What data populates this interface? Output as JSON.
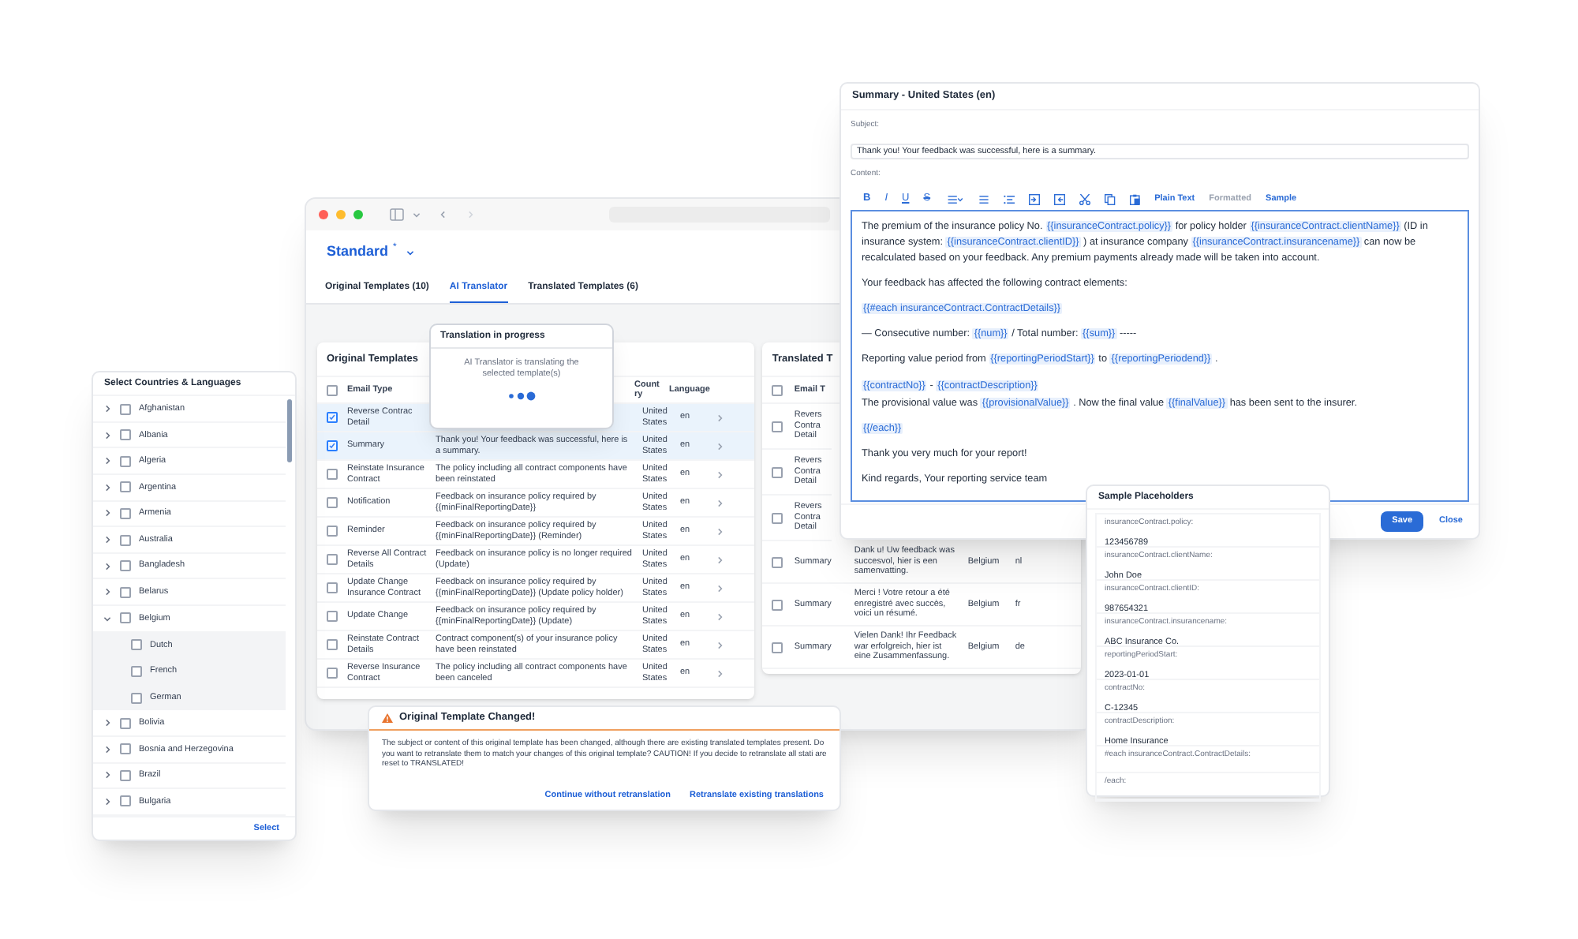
{
  "app_window": {
    "header": {
      "title": "Standard",
      "modified_mark": "*"
    },
    "tabs": [
      {
        "label": "Original Templates (10)",
        "selected": false
      },
      {
        "label": "AI Translator",
        "selected": true
      },
      {
        "label": "Translated Templates (6)",
        "selected": false
      }
    ],
    "original_templates": {
      "title": "Original Templates",
      "all_checked": false,
      "columns": [
        "Email Type",
        "Country",
        "Language"
      ],
      "rows": [
        {
          "email_type": "Reverse Contrac Detail",
          "country": "United States",
          "language": "en",
          "selected": true
        },
        {
          "email_type": "Summary",
          "subject": "Thank you! Your feedback was successful, here is a summary.",
          "country": "United States",
          "language": "en",
          "selected": true
        },
        {
          "email_type": "Reinstate Insurance Contract",
          "subject": "The policy including all contract components have been reinstated",
          "country": "United States",
          "language": "en",
          "selected": false
        },
        {
          "email_type": "Notification",
          "subject": "Feedback on insurance policy required by {{minFinalReportingDate}}",
          "country": "United States",
          "language": "en",
          "selected": false
        },
        {
          "email_type": "Reminder",
          "subject": "Feedback on insurance policy required by {{minFinalReportingDate}} (Reminder)",
          "country": "United States",
          "language": "en",
          "selected": false
        },
        {
          "email_type": "Reverse All Contract Details",
          "subject": "Feedback on insurance policy is no longer required (Update)",
          "country": "United States",
          "language": "en",
          "selected": false
        },
        {
          "email_type": "Update Change Insurance Contract",
          "subject": "Feedback on insurance policy required by {{minFinalReportingDate}} (Update policy holder)",
          "country": "United States",
          "language": "en",
          "selected": false
        },
        {
          "email_type": "Update Change",
          "subject": "Feedback on insurance policy required by {{minFinalReportingDate}} (Update)",
          "country": "United States",
          "language": "en",
          "selected": false
        },
        {
          "email_type": "Reinstate Contract Details",
          "subject": "Contract component(s) of your insurance policy have been reinstated",
          "country": "United States",
          "language": "en",
          "selected": false
        },
        {
          "email_type": "Reverse Insurance Contract",
          "subject": "The policy including all contract components have been canceled",
          "country": "United States",
          "language": "en",
          "selected": false
        }
      ]
    },
    "translated_templates": {
      "title": "Translated T",
      "all_checked": false,
      "columns": [
        "Email T"
      ],
      "rows": [
        {
          "email_type": "Revers Contra Detail",
          "selected": false
        },
        {
          "email_type": "Revers Contra Detail",
          "selected": false
        },
        {
          "email_type": "Revers Contra Detail",
          "selected": false
        },
        {
          "email_type": "Summary",
          "subject": "Dank u! Uw feedback was succesvol, hier is een samenvatting.",
          "country": "Belgium",
          "language": "nl",
          "selected": false
        },
        {
          "email_type": "Summary",
          "subject": "Merci ! Votre retour a été enregistré avec succès, voici un résumé.",
          "country": "Belgium",
          "language": "fr",
          "selected": false
        },
        {
          "email_type": "Summary",
          "subject": "Vielen Dank! Ihr Feedback war erfolgreich, hier ist eine Zusammenfassung.",
          "country": "Belgium",
          "language": "de",
          "selected": false
        }
      ]
    }
  },
  "progress_popup": {
    "title": "Translation in progress",
    "message": "AI Translator is translating the selected template(s)"
  },
  "country_panel": {
    "title": "Select Countries & Languages",
    "items": [
      {
        "label": "Afghanistan",
        "expanded": false,
        "checked": false
      },
      {
        "label": "Albania",
        "expanded": false,
        "checked": false
      },
      {
        "label": "Algeria",
        "expanded": false,
        "checked": false
      },
      {
        "label": "Argentina",
        "expanded": false,
        "checked": false
      },
      {
        "label": "Armenia",
        "expanded": false,
        "checked": false
      },
      {
        "label": "Australia",
        "expanded": false,
        "checked": false
      },
      {
        "label": "Bangladesh",
        "expanded": false,
        "checked": false
      },
      {
        "label": "Belarus",
        "expanded": false,
        "checked": false
      },
      {
        "label": "Belgium",
        "expanded": true,
        "checked": false,
        "children": [
          {
            "label": "Dutch",
            "checked": false
          },
          {
            "label": "French",
            "checked": false
          },
          {
            "label": "German",
            "checked": false
          }
        ]
      },
      {
        "label": "Bolivia",
        "expanded": false,
        "checked": false
      },
      {
        "label": "Bosnia and Herzegovina",
        "expanded": false,
        "checked": false
      },
      {
        "label": "Brazil",
        "expanded": false,
        "checked": false
      },
      {
        "label": "Bulgaria",
        "expanded": false,
        "checked": false
      }
    ],
    "button": "Select"
  },
  "change_dialog": {
    "title": "Original Template Changed!",
    "message": "The subject or content of this original template has been changed, although there are existing translated templates present. Do you want to retranslate them to match your changes of this original template? CAUTION! If you decide to retranslate all stati are reset to TRANSLATED!",
    "buttons": [
      "Continue without retranslation",
      "Retranslate existing translations"
    ]
  },
  "summary_window": {
    "title": "Summary - United States (en)",
    "subject_label": "Subject:",
    "subject": "Thank you! Your feedback was successful, here is a summary.",
    "content_label": "Content:",
    "format_buttons": [
      "B",
      "I",
      "U",
      "S"
    ],
    "modes": [
      {
        "label": "Plain Text",
        "disabled": false
      },
      {
        "label": "Formatted",
        "disabled": true
      },
      {
        "label": "Sample",
        "disabled": false
      }
    ],
    "paragraphs": [
      [
        {
          "kind": "text",
          "text": "The premium of the insurance policy No."
        },
        {
          "kind": "token",
          "text": "{{insuranceContract.policy}}"
        },
        {
          "kind": "text",
          "text": "for policy holder"
        },
        {
          "kind": "token",
          "text": "{{insuranceContract.clientName}}"
        },
        {
          "kind": "text",
          "text": "(ID in insurance system:"
        },
        {
          "kind": "token",
          "text": "{{insuranceContract.clientID}}"
        },
        {
          "kind": "text",
          "text": ") at insurance company"
        },
        {
          "kind": "token",
          "text": "{{insuranceContract.insurancename}}"
        },
        {
          "kind": "text",
          "text": "can now be recalculated based on your feedback. Any premium payments already made will be taken into account."
        }
      ],
      [
        {
          "kind": "text",
          "text": "Your feedback has affected the following contract elements:"
        }
      ],
      [
        {
          "kind": "token",
          "text": "{{#each insuranceContract.ContractDetails}}"
        }
      ],
      [
        {
          "kind": "text",
          "text": "— Consecutive number:"
        },
        {
          "kind": "token",
          "text": "{{num}}"
        },
        {
          "kind": "text",
          "text": "/ Total number:"
        },
        {
          "kind": "token",
          "text": "{{sum}}"
        },
        {
          "kind": "text",
          "text": "-----"
        }
      ],
      [
        {
          "kind": "text",
          "text": "Reporting value period from"
        },
        {
          "kind": "token",
          "text": "{{reportingPeriodStart}}"
        },
        {
          "kind": "text",
          "text": "to"
        },
        {
          "kind": "token",
          "text": "{{reportingPeriodend}}"
        },
        {
          "kind": "text",
          "text": "."
        }
      ],
      [
        {
          "kind": "token",
          "text": "{{contractNo}}"
        },
        {
          "kind": "text",
          "text": "-"
        },
        {
          "kind": "token",
          "text": "{{contractDescription}}"
        },
        {
          "kind": "break"
        },
        {
          "kind": "text",
          "text": "The provisional value was"
        },
        {
          "kind": "token",
          "text": "{{provisionalValue}}"
        },
        {
          "kind": "text",
          "text": ". Now the final value"
        },
        {
          "kind": "token",
          "text": "{{finalValue}}"
        },
        {
          "kind": "text",
          "text": "has been sent to the insurer."
        }
      ],
      [
        {
          "kind": "token",
          "text": "{{/each}}"
        }
      ],
      [
        {
          "kind": "text",
          "text": "Thank you very much for your report!"
        }
      ],
      [
        {
          "kind": "text",
          "text": "Kind regards, Your reporting service team"
        }
      ]
    ],
    "buttons": [
      "Save",
      "Close"
    ]
  },
  "sample_placeholders": {
    "title": "Sample Placeholders",
    "items": [
      {
        "label": "insuranceContract.policy:",
        "value": "123456789"
      },
      {
        "label": "insuranceContract.clientName:",
        "value": "John Doe"
      },
      {
        "label": "insuranceContract.clientID:",
        "value": "987654321"
      },
      {
        "label": "insuranceContract.insurancename:",
        "value": "ABC Insurance Co."
      },
      {
        "label": "reportingPeriodStart:",
        "value": "2023-01-01"
      },
      {
        "label": "contractNo:",
        "value": "C-12345"
      },
      {
        "label": "contractDescription:",
        "value": "Home Insurance"
      },
      {
        "label": "#each insuranceContract.ContractDetails:"
      },
      {
        "label": "/each:"
      }
    ]
  }
}
